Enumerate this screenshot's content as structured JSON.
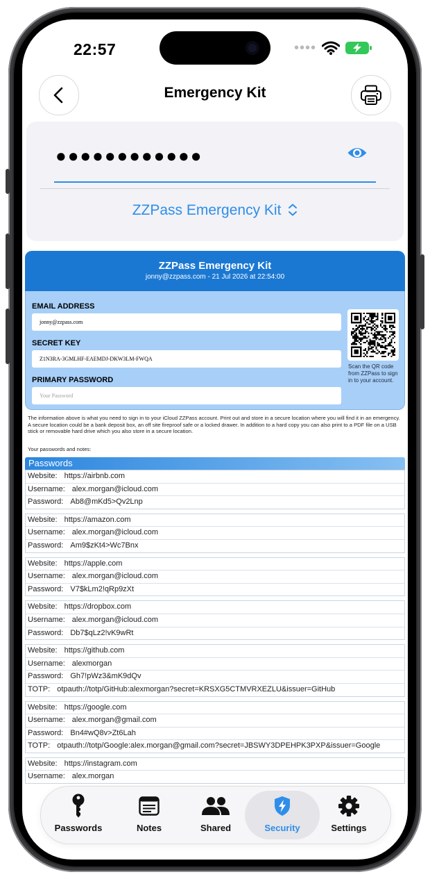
{
  "status": {
    "time": "22:57"
  },
  "nav": {
    "title": "Emergency Kit"
  },
  "password_card": {
    "masked_value": "●●●●●●●●●●●●",
    "kit_selector": "ZZPass Emergency Kit"
  },
  "doc": {
    "title": "ZZPass Emergency Kit",
    "subtitle": "jonny@zzpass.com - 21 Jul 2026 at 22:54:00",
    "email_label": "EMAIL ADDRESS",
    "email_value": "jonny@zzpass.com",
    "secret_label": "SECRET KEY",
    "secret_value": "Z1N3RA-3GMLHF-EAEMDJ-DKW3LM-FWQA",
    "primary_label": "PRIMARY PASSWORD",
    "primary_placeholder": "Your Password",
    "qr_note": "Scan the QR code from ZZPass to sign in to your account.",
    "info": "The information above is what you need to sign in to your iCloud ZZPass account. Print out and store in a secure location where you will find it in an emergency. A secure location could be a bank deposit box, an off site fireproof safe or a locked drawer. In addition to a hard copy you can also print to a PDF file on a USB stick or removable hard drive which you also store in a secure location.",
    "your_passwords": "Your passwords and notes:",
    "section_title": "Passwords"
  },
  "entries": [
    {
      "website": "https://airbnb.com",
      "username": "alex.morgan@icloud.com",
      "password": "Ab8@mKd5>Qv2Lnp"
    },
    {
      "website": "https://amazon.com",
      "username": "alex.morgan@icloud.com",
      "password": "Am9$zKt4>Wc7Bnx"
    },
    {
      "website": "https://apple.com",
      "username": "alex.morgan@icloud.com",
      "password": "V7$kLm2!qRp9zXt"
    },
    {
      "website": "https://dropbox.com",
      "username": "alex.morgan@icloud.com",
      "password": "Db7$qLz2!vK9wRt"
    },
    {
      "website": "https://github.com",
      "username": "alexmorgan",
      "password": "Gh7!pWz3&mK9dQv",
      "totp": "otpauth://totp/GitHub:alexmorgan?secret=KRSXG5CTMVRXEZLU&issuer=GitHub"
    },
    {
      "website": "https://google.com",
      "username": "alex.morgan@gmail.com",
      "password": "Bn4#wQ8v>Zt6Lah",
      "totp": "otpauth://totp/Google:alex.morgan@gmail.com?secret=JBSWY3DPEHPK3PXP&issuer=Google"
    },
    {
      "website": "https://instagram.com",
      "username": "alex.morgan"
    }
  ],
  "field_labels": {
    "website": "Website:",
    "username": "Username:",
    "password": "Password:",
    "totp": "TOTP:"
  },
  "tabs": [
    {
      "label": "Passwords",
      "icon": "key-icon"
    },
    {
      "label": "Notes",
      "icon": "notes-icon"
    },
    {
      "label": "Shared",
      "icon": "people-icon"
    },
    {
      "label": "Security",
      "icon": "shield-bolt-icon",
      "active": true
    },
    {
      "label": "Settings",
      "icon": "gear-icon"
    }
  ],
  "colors": {
    "accent": "#2f8ee7",
    "doc_header": "#1b78d2",
    "doc_form": "#a8cff8",
    "battery": "#34c759"
  }
}
